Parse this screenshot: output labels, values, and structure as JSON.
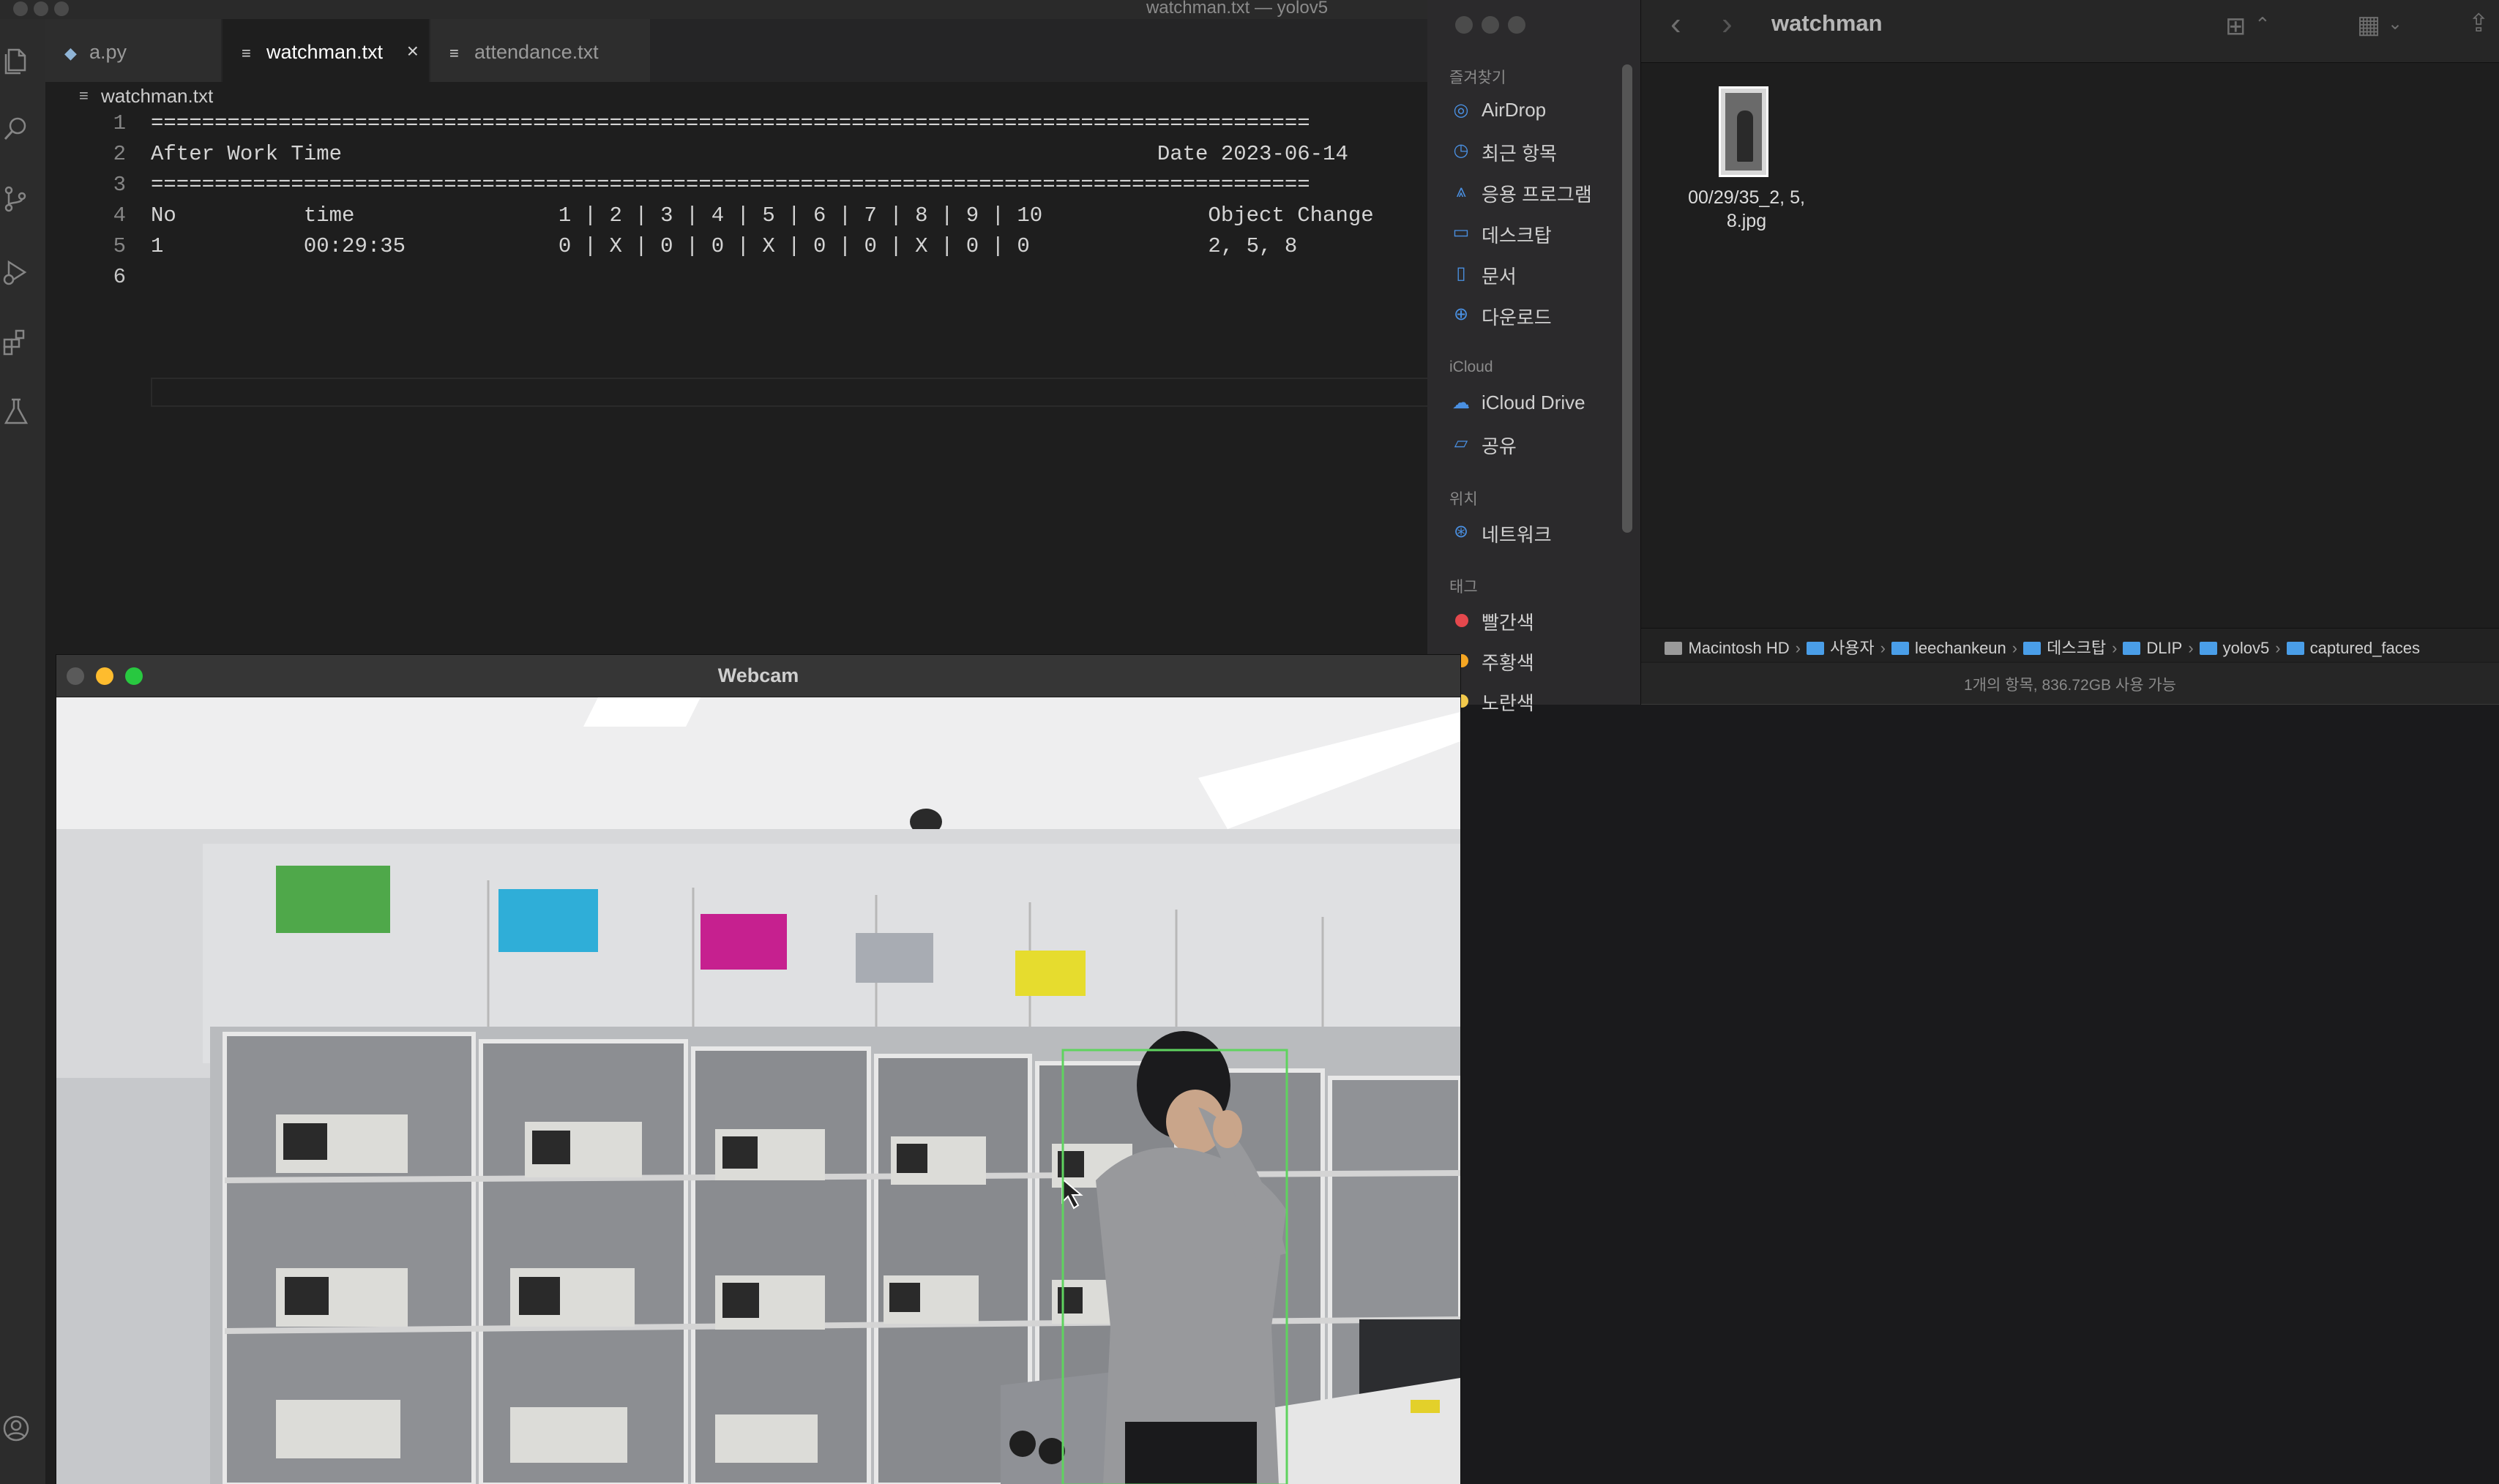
{
  "vscode": {
    "window_title": "watchman.txt — yolov5",
    "tabs": [
      {
        "label": "a.py"
      },
      {
        "label": "watchman.txt",
        "close": "×"
      },
      {
        "label": "attendance.txt"
      }
    ],
    "breadcrumb": "watchman.txt",
    "lines": [
      {
        "no": "1",
        "text": "==========================================================================================="
      },
      {
        "no": "2",
        "text": "After Work Time                                                                Date 2023-06-14"
      },
      {
        "no": "3",
        "text": "==========================================================================================="
      },
      {
        "no": "4",
        "text": "No          time                1 | 2 | 3 | 4 | 5 | 6 | 7 | 8 | 9 | 10             Object Change"
      },
      {
        "no": "5",
        "text": "1           00:29:35            0 | X | 0 | 0 | X | 0 | 0 | X | 0 | 0              2, 5, 8"
      },
      {
        "no": "6",
        "text": ""
      }
    ]
  },
  "finder": {
    "title": "watchman",
    "sections": {
      "favorites": "즐겨찾기",
      "icloud": "iCloud",
      "locations": "위치",
      "tags": "태그"
    },
    "favorites": [
      {
        "label": "AirDrop",
        "icon": "airdrop-icon"
      },
      {
        "label": "최근 항목",
        "icon": "clock-icon"
      },
      {
        "label": "응용 프로그램",
        "icon": "apps-icon"
      },
      {
        "label": "데스크탑",
        "icon": "desktop-icon"
      },
      {
        "label": "문서",
        "icon": "document-icon"
      },
      {
        "label": "다운로드",
        "icon": "download-icon"
      }
    ],
    "icloud": [
      {
        "label": "iCloud Drive",
        "icon": "cloud-icon"
      },
      {
        "label": "공유",
        "icon": "shared-folder-icon"
      }
    ],
    "locations": [
      {
        "label": "네트워크",
        "icon": "network-icon"
      }
    ],
    "tags": [
      {
        "label": "빨간색",
        "color": "#e5484d"
      },
      {
        "label": "주황색",
        "color": "#f5a623"
      },
      {
        "label": "노란색",
        "color": "#f2c94c"
      }
    ],
    "file": {
      "name_line1": "00/29/35_2, 5,",
      "name_line2": "8.jpg"
    },
    "path": [
      {
        "label": "Macintosh HD",
        "kind": "disk"
      },
      {
        "label": "사용자",
        "kind": "folder"
      },
      {
        "label": "leechankeun",
        "kind": "folder"
      },
      {
        "label": "데스크탑",
        "kind": "folder"
      },
      {
        "label": "DLIP",
        "kind": "folder"
      },
      {
        "label": "yolov5",
        "kind": "folder"
      },
      {
        "label": "captured_faces",
        "kind": "folder"
      }
    ],
    "path_sep": "›",
    "status": "1개의 항목, 836.72GB 사용 가능"
  },
  "webcam": {
    "title": "Webcam",
    "colors": {
      "close": "#ff5f57",
      "minimize": "#febc2e",
      "zoom": "#28c840",
      "detection_box": "#5fd35f"
    }
  }
}
